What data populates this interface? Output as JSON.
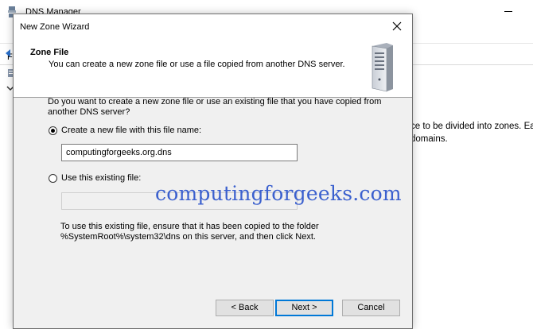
{
  "background_window": {
    "title": "DNS Manager",
    "menu_letter": "F",
    "description_line1": "ce to be divided into zones. Ea",
    "description_line2": "domains.",
    "description_mark": "."
  },
  "dialog": {
    "title": "New Zone Wizard",
    "header": {
      "title": "Zone File",
      "subtitle": "You can create a new zone file or use a file copied from another DNS server."
    },
    "question": "Do you want to create a new zone file or use an existing file that you have copied from another DNS server?",
    "option_new": {
      "label": "Create a new file with this file name:",
      "selected": true,
      "value": "computingforgeeks.org.dns"
    },
    "option_existing": {
      "label": "Use this existing file:",
      "selected": false,
      "value": ""
    },
    "help_text_line1": "To use this existing file, ensure that it has been copied to the folder",
    "help_text_line2": "%SystemRoot%\\system32\\dns on this server, and then click Next.",
    "buttons": {
      "back": "< Back",
      "next": "Next >",
      "cancel": "Cancel"
    }
  },
  "watermark": "computingforgeeks.com",
  "colors": {
    "accent": "#0078d7",
    "watermark": "#3b60ce",
    "dialog_bg": "#f0f0f0"
  },
  "icons": [
    "dns-manager-icon",
    "close-icon",
    "server-icon",
    "back-arrow-icon",
    "tree-node-icon",
    "chevron-down-icon"
  ]
}
